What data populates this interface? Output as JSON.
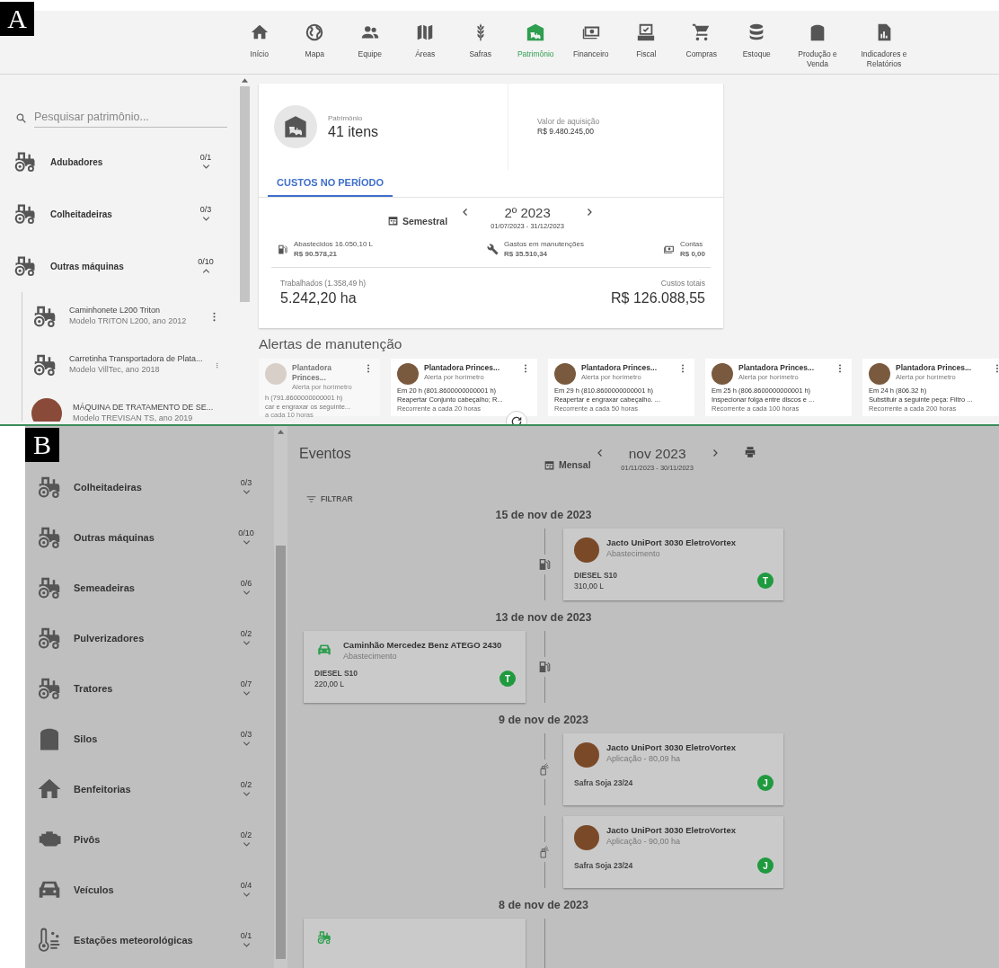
{
  "panel_a": {
    "label": "A",
    "nav": [
      {
        "label": "Início",
        "selected": false
      },
      {
        "label": "Mapa",
        "selected": false
      },
      {
        "label": "Equipe",
        "selected": false
      },
      {
        "label": "Áreas",
        "selected": false
      },
      {
        "label": "Safras",
        "selected": false
      },
      {
        "label": "Patrimônio",
        "selected": true
      },
      {
        "label": "Financeiro",
        "selected": false
      },
      {
        "label": "Fiscal",
        "selected": false
      },
      {
        "label": "Compras",
        "selected": false
      },
      {
        "label": "Estoque",
        "selected": false
      },
      {
        "label": "Produção e Venda",
        "selected": false
      },
      {
        "label": "Indicadores e Relatórios",
        "selected": false
      }
    ],
    "sidebar": {
      "placeholder": "Pesquisar patrimônio...",
      "groups": [
        {
          "kind": "tractor",
          "name": "Adubadores",
          "count": "0/1",
          "expanded": false
        },
        {
          "kind": "tractor",
          "name": "Colheitadeiras",
          "count": "0/3",
          "expanded": false
        },
        {
          "kind": "tractor",
          "name": "Outras máquinas",
          "count": "0/10",
          "expanded": true,
          "children": [
            {
              "kind": "machine",
              "title": "Caminhonete L200 Triton",
              "subtitle": "Modelo TRITON L200, ano 2012"
            },
            {
              "kind": "machine",
              "title": "Carretinha Transportadora de Plata...",
              "subtitle": "Modelo VillTec, ano 2018"
            },
            {
              "kind": "photo",
              "title": "MÁQUINA DE TRATAMENTO DE SE...",
              "subtitle": "Modelo TREVISAN TS, ano 2019"
            }
          ]
        }
      ]
    },
    "summary": {
      "caption": "Patrimônio",
      "count": "41 itens",
      "acquisition_label": "Valor de aquisição",
      "acquisition_value": "R$ 9.480.245,00",
      "tab": {
        "label": "CUSTOS NO PERÍODO",
        "selected": true
      },
      "period": {
        "mode": "Semestral",
        "title": "2º 2023",
        "range": "01/07/2023 - 31/12/2023"
      },
      "stats": [
        {
          "label": "Abastecidos 16.050,10 L",
          "value": "R$ 90.578,21"
        },
        {
          "label": "Gastos em manutenções",
          "value": "R$ 35.510,34"
        },
        {
          "label": "Contas",
          "value": "R$ 0,00"
        }
      ],
      "worked_label": "Trabalhados (1.358,49 h)",
      "worked_value": "5.242,20 ha",
      "total_label": "Custos totais",
      "total_value": "R$ 126.088,55"
    },
    "alerts": {
      "title": "Alertas de manutenção",
      "cards": [
        {
          "faded": true,
          "title": "Plantadora Princes...",
          "subtitle": "Alerta por horímetro",
          "due": "h (791.8600000000001 h)",
          "task": "car e engraxar os seguinte...",
          "recurrence": "a cada 10 horas"
        },
        {
          "faded": false,
          "title": "Plantadora Princes...",
          "subtitle": "Alerta por horímetro",
          "due": "Em 20 h (801.8600000000001 h)",
          "task": "Reapertar Conjunto cabeçalho; R...",
          "recurrence": "Recorrente a cada 20 horas"
        },
        {
          "faded": false,
          "title": "Plantadora Princes...",
          "subtitle": "Alerta por horímetro",
          "due": "Em 29 h (810.8600000000001 h)",
          "task": "Reapertar e engraxar cabeçalho. ...",
          "recurrence": "Recorrente a cada 50 horas"
        },
        {
          "faded": false,
          "title": "Plantadora Princes...",
          "subtitle": "Alerta por horímetro",
          "due": "Em 25 h (806.8600000000001 h)",
          "task": "Inspecionar folga entre discos e ...",
          "recurrence": "Recorrente a cada 100 horas"
        },
        {
          "faded": false,
          "title": "Plantadora Princes...",
          "subtitle": "Alerta por horímetro",
          "due": "Em 24 h (806.32 h)",
          "task": "Substituir a seguinte peça: Filtro ...",
          "recurrence": "Recorrente a cada 200 horas"
        }
      ]
    }
  },
  "panel_b": {
    "label": "B",
    "sidebar": {
      "groups": [
        {
          "kind": "tractor",
          "name": "Colheitadeiras",
          "count": "0/3",
          "expanded": false
        },
        {
          "kind": "tractor",
          "name": "Outras máquinas",
          "count": "0/10",
          "expanded": false
        },
        {
          "kind": "tractor",
          "name": "Semeadeiras",
          "count": "0/6",
          "expanded": false
        },
        {
          "kind": "tractor",
          "name": "Pulverizadores",
          "count": "0/2",
          "expanded": false
        },
        {
          "kind": "tractor",
          "name": "Tratores",
          "count": "0/7",
          "expanded": false
        },
        {
          "kind": "silo",
          "name": "Silos",
          "count": "0/3",
          "expanded": false
        },
        {
          "kind": "house",
          "name": "Benfeitorias",
          "count": "0/2",
          "expanded": false
        },
        {
          "kind": "engine",
          "name": "Pivôs",
          "count": "0/2",
          "expanded": false
        },
        {
          "kind": "car",
          "name": "Veículos",
          "count": "0/4",
          "expanded": false
        },
        {
          "kind": "weather",
          "name": "Estações meteorológicas",
          "count": "0/1",
          "expanded": false
        }
      ]
    },
    "events": {
      "title": "Eventos",
      "mode": "Mensal",
      "period": "nov 2023",
      "range": "01/11/2023 - 30/11/2023",
      "filter": "FILTRAR",
      "days": [
        {
          "date": "15 de nov de 2023",
          "events": [
            {
              "left": false,
              "avatar": {
                "kind": "photo"
              },
              "marker": {
                "kind": "fuel"
              },
              "title": "Jacto UniPort 3030 EletroVortex",
              "subtitle": "Abastecimento",
              "detail": "DIESEL S10",
              "amount": "310,00 L",
              "badge": "T"
            }
          ]
        },
        {
          "date": "13 de nov de 2023",
          "events": [
            {
              "left": true,
              "avatar": {
                "kind": "car"
              },
              "marker": {
                "kind": "fuel"
              },
              "title": "Caminhão Mercedez Benz ATEGO 2430",
              "subtitle": "Abastecimento",
              "detail": "DIESEL S10",
              "amount": "220,00 L",
              "badge": "T"
            }
          ]
        },
        {
          "date": "9 de nov de 2023",
          "events": [
            {
              "left": false,
              "avatar": {
                "kind": "photo"
              },
              "marker": {
                "kind": "spray"
              },
              "title": "Jacto UniPort 3030 EletroVortex",
              "subtitle": "Aplicação - 80,09 ha",
              "detail": "Safra Soja 23/24",
              "badge": "J"
            },
            {
              "left": false,
              "avatar": {
                "kind": "photo"
              },
              "marker": {
                "kind": "spray"
              },
              "title": "Jacto UniPort 3030 EletroVortex",
              "subtitle": "Aplicação - 90,00 ha",
              "detail": "Safra Soja 23/24",
              "badge": "J"
            }
          ]
        },
        {
          "date": "8 de nov de 2023",
          "events": [
            {
              "left": true,
              "avatar": {
                "kind": "tractor"
              }
            }
          ]
        }
      ]
    }
  }
}
